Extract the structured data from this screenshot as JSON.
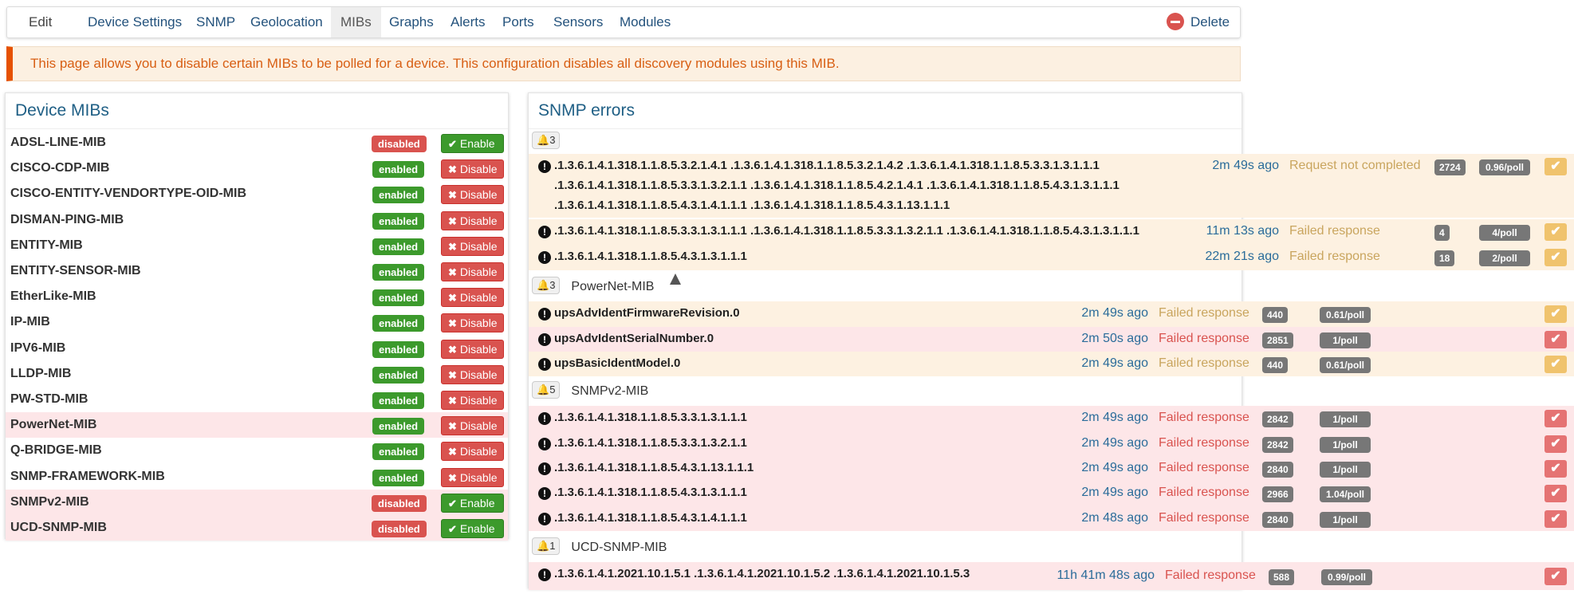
{
  "nav": {
    "tabs": [
      "Edit",
      "Device Settings",
      "SNMP",
      "Geolocation",
      "MIBs",
      "Graphs",
      "Alerts",
      "Ports",
      "Sensors",
      "Modules"
    ],
    "active_tab": "MIBs",
    "delete_label": "Delete"
  },
  "banner": {
    "text": "This page allows you to disable certain MIBs to be polled for a device. This configuration disables all discovery modules using this MIB."
  },
  "device_mibs": {
    "title": "Device MIBs",
    "rows": [
      {
        "name": "ADSL-LINE-MIB",
        "status": "disabled",
        "action": "Enable"
      },
      {
        "name": "CISCO-CDP-MIB",
        "status": "enabled",
        "action": "Disable"
      },
      {
        "name": "CISCO-ENTITY-VENDORTYPE-OID-MIB",
        "status": "enabled",
        "action": "Disable"
      },
      {
        "name": "DISMAN-PING-MIB",
        "status": "enabled",
        "action": "Disable"
      },
      {
        "name": "ENTITY-MIB",
        "status": "enabled",
        "action": "Disable"
      },
      {
        "name": "ENTITY-SENSOR-MIB",
        "status": "enabled",
        "action": "Disable"
      },
      {
        "name": "EtherLike-MIB",
        "status": "enabled",
        "action": "Disable"
      },
      {
        "name": "IP-MIB",
        "status": "enabled",
        "action": "Disable"
      },
      {
        "name": "IPV6-MIB",
        "status": "enabled",
        "action": "Disable"
      },
      {
        "name": "LLDP-MIB",
        "status": "enabled",
        "action": "Disable"
      },
      {
        "name": "PW-STD-MIB",
        "status": "enabled",
        "action": "Disable"
      },
      {
        "name": "PowerNet-MIB",
        "status": "enabled",
        "action": "Disable",
        "highlight": true
      },
      {
        "name": "Q-BRIDGE-MIB",
        "status": "enabled",
        "action": "Disable"
      },
      {
        "name": "SNMP-FRAMEWORK-MIB",
        "status": "enabled",
        "action": "Disable"
      },
      {
        "name": "SNMPv2-MIB",
        "status": "disabled",
        "action": "Enable",
        "highlight": true
      },
      {
        "name": "UCD-SNMP-MIB",
        "status": "disabled",
        "action": "Enable",
        "highlight": true
      }
    ]
  },
  "snmp_errors": {
    "title": "SNMP errors",
    "groups": [
      {
        "count": "3",
        "name": "",
        "rows": [
          {
            "oid_lines": [
              ".1.3.6.1.4.1.318.1.1.8.5.3.2.1.4.1 .1.3.6.1.4.1.318.1.1.8.5.3.2.1.4.2 .1.3.6.1.4.1.318.1.1.8.5.3.3.1.3.1.1.1",
              ".1.3.6.1.4.1.318.1.1.8.5.3.3.1.3.2.1.1 .1.3.6.1.4.1.318.1.1.8.5.4.2.1.4.1 .1.3.6.1.4.1.318.1.1.8.5.4.3.1.3.1.1.1",
              ".1.3.6.1.4.1.318.1.1.8.5.4.3.1.4.1.1.1 .1.3.6.1.4.1.318.1.1.8.5.4.3.1.13.1.1.1"
            ],
            "time": "2m 49s ago",
            "status": "Request not completed",
            "count": "2724",
            "rate": "0.96/poll",
            "level": "warn"
          },
          {
            "oid_lines": [
              ".1.3.6.1.4.1.318.1.1.8.5.3.3.1.3.1.1.1 .1.3.6.1.4.1.318.1.1.8.5.3.3.1.3.2.1.1 .1.3.6.1.4.1.318.1.1.8.5.4.3.1.3.1.1.1"
            ],
            "time": "11m 13s ago",
            "status": "Failed response",
            "count": "4",
            "rate": "4/poll",
            "level": "warn"
          },
          {
            "oid_lines": [
              ".1.3.6.1.4.1.318.1.1.8.5.4.3.1.3.1.1.1"
            ],
            "time": "22m 21s ago",
            "status": "Failed response",
            "count": "18",
            "rate": "2/poll",
            "level": "warn"
          }
        ]
      },
      {
        "count": "3",
        "name": "PowerNet-MIB",
        "rows": [
          {
            "oid_lines": [
              "upsAdvIdentFirmwareRevision.0"
            ],
            "time": "2m 49s ago",
            "status": "Failed response",
            "count": "440",
            "rate": "0.61/poll",
            "level": "warn"
          },
          {
            "oid_lines": [
              "upsAdvIdentSerialNumber.0"
            ],
            "time": "2m 50s ago",
            "status": "Failed response",
            "count": "2851",
            "rate": "1/poll",
            "level": "danger"
          },
          {
            "oid_lines": [
              "upsBasicIdentModel.0"
            ],
            "time": "2m 49s ago",
            "status": "Failed response",
            "count": "440",
            "rate": "0.61/poll",
            "level": "warn"
          }
        ]
      },
      {
        "count": "5",
        "name": "SNMPv2-MIB",
        "rows": [
          {
            "oid_lines": [
              ".1.3.6.1.4.1.318.1.1.8.5.3.3.1.3.1.1.1"
            ],
            "time": "2m 49s ago",
            "status": "Failed response",
            "count": "2842",
            "rate": "1/poll",
            "level": "danger"
          },
          {
            "oid_lines": [
              ".1.3.6.1.4.1.318.1.1.8.5.3.3.1.3.2.1.1"
            ],
            "time": "2m 49s ago",
            "status": "Failed response",
            "count": "2842",
            "rate": "1/poll",
            "level": "danger"
          },
          {
            "oid_lines": [
              ".1.3.6.1.4.1.318.1.1.8.5.4.3.1.13.1.1.1"
            ],
            "time": "2m 49s ago",
            "status": "Failed response",
            "count": "2840",
            "rate": "1/poll",
            "level": "danger"
          },
          {
            "oid_lines": [
              ".1.3.6.1.4.1.318.1.1.8.5.4.3.1.3.1.1.1"
            ],
            "time": "2m 49s ago",
            "status": "Failed response",
            "count": "2966",
            "rate": "1.04/poll",
            "level": "danger"
          },
          {
            "oid_lines": [
              ".1.3.6.1.4.1.318.1.1.8.5.4.3.1.4.1.1.1"
            ],
            "time": "2m 48s ago",
            "status": "Failed response",
            "count": "2840",
            "rate": "1/poll",
            "level": "danger"
          }
        ]
      },
      {
        "count": "1",
        "name": "UCD-SNMP-MIB",
        "rows": [
          {
            "oid_lines": [
              ".1.3.6.1.4.1.2021.10.1.5.1 .1.3.6.1.4.1.2021.10.1.5.2 .1.3.6.1.4.1.2021.10.1.5.3"
            ],
            "time": "11h 41m 48s ago",
            "status": "Failed response",
            "count": "588",
            "rate": "0.99/poll",
            "level": "danger"
          }
        ]
      }
    ]
  },
  "icons": {
    "error": "exclamation-circle-icon",
    "bell": "bell-icon",
    "check": "check-icon",
    "times": "times-icon",
    "delete": "minus-circle-icon"
  },
  "colors": {
    "enabled": "#3c9a2c",
    "disabled": "#d9534f",
    "warning_row": "#fdf1e1",
    "danger_row": "#fde6e8",
    "banner_accent": "#e65100"
  }
}
